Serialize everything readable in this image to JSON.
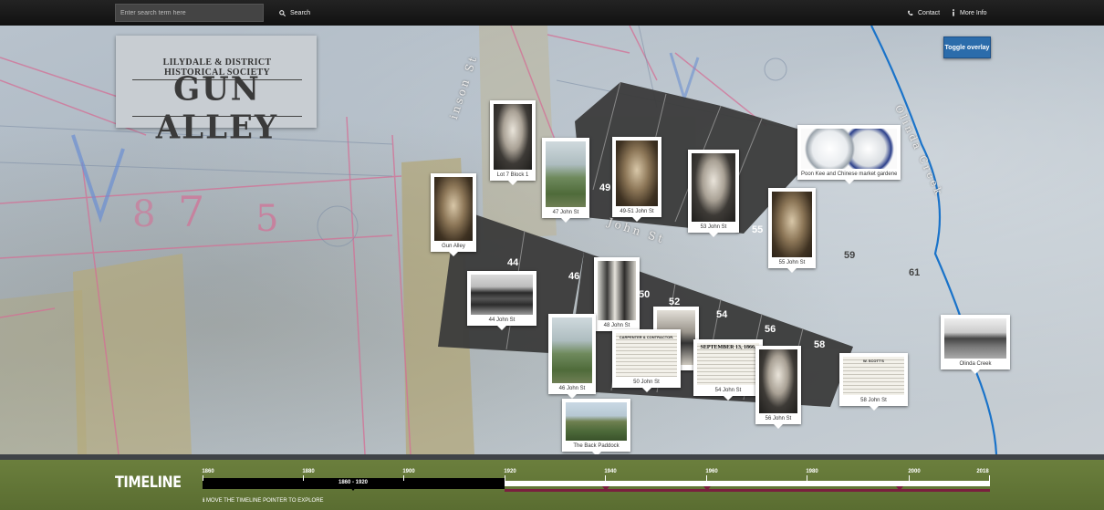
{
  "topbar": {
    "search_placeholder": "Enter search term here",
    "search_label": "Search",
    "contact_label": "Contact",
    "more_info_label": "More Info"
  },
  "logo": {
    "subtitle": "LILYDALE & DISTRICT HISTORICAL SOCIETY",
    "title": "GUN ALLEY"
  },
  "toggle_label": "Toggle overlay",
  "streets": {
    "hutchinson": "inson St",
    "john": "John St",
    "olinda": "Olinda Creek"
  },
  "lots": [
    "44",
    "46",
    "49",
    "50",
    "52",
    "54",
    "55",
    "56",
    "58",
    "59",
    "61"
  ],
  "cards": [
    {
      "caption": "Lot 7 Block 1"
    },
    {
      "caption": "Gun Alley"
    },
    {
      "caption": "47 John St"
    },
    {
      "caption": "49-51 John St"
    },
    {
      "caption": "53 John St"
    },
    {
      "caption": "Poon Kee and Chinese market gardeners"
    },
    {
      "caption": "55 John St"
    },
    {
      "caption": "44 John St"
    },
    {
      "caption": "48 John St"
    },
    {
      "caption": "46 John St"
    },
    {
      "caption": "50 John St"
    },
    {
      "caption": "54 John St"
    },
    {
      "caption": "56 John St"
    },
    {
      "caption": "58 John St"
    },
    {
      "caption": "The Back Paddock"
    },
    {
      "caption": "Olinda Creek"
    }
  ],
  "clippings": {
    "c50_head": "CARPENTER & CONTRACTOR.",
    "c54_date": "SEPTEMBER 13, 1866.",
    "c58_head": "W. SCOTT'S"
  },
  "timeline": {
    "title": "TIMELINE",
    "years": [
      "1860",
      "1880",
      "1900",
      "1920",
      "1940",
      "1960",
      "1980",
      "2000",
      "2018"
    ],
    "range": "1860 - 1920",
    "hint": "MOVE THE TIMELINE POINTER TO EXPLORE"
  },
  "colors": {
    "toggle": "#2b6cab",
    "timeline_maroon": "#7a1f3e",
    "footer_green": "#647837",
    "creek_blue": "#1a73c9"
  }
}
